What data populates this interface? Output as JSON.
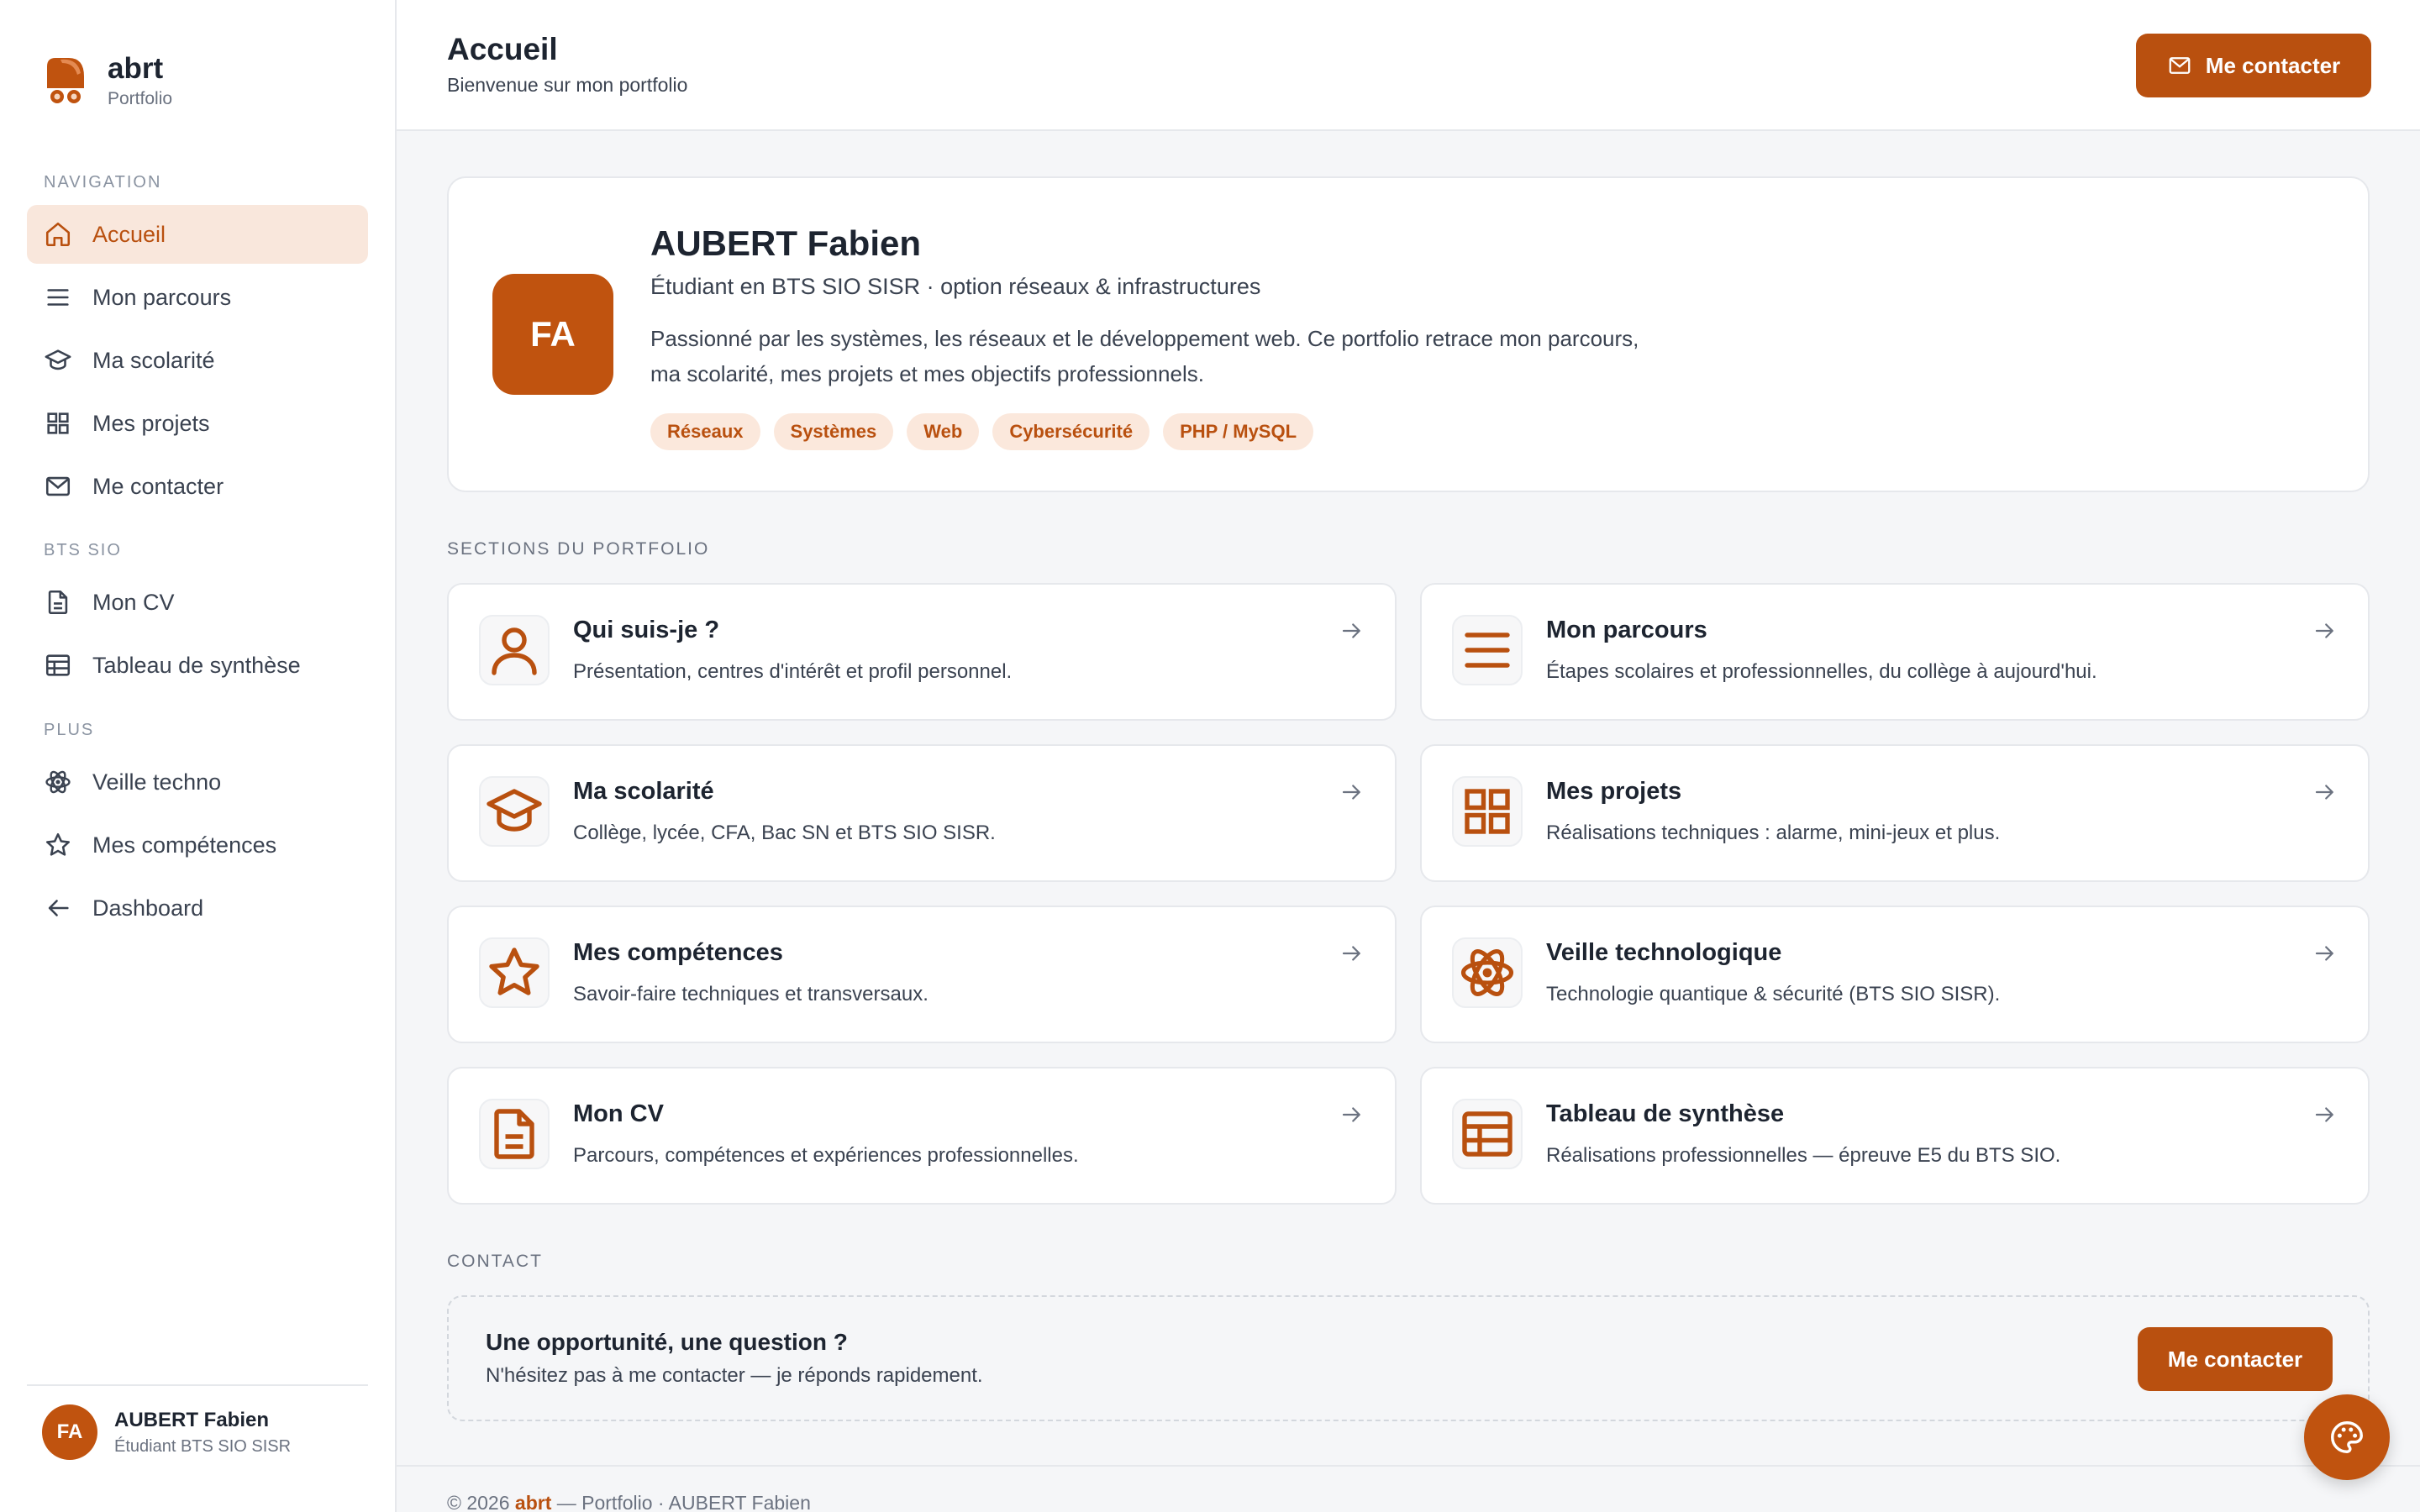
{
  "brand": {
    "name": "abrt",
    "subtitle": "Portfolio",
    "logo_icon": "brand-logo-icon"
  },
  "sidebar": {
    "groups": [
      {
        "label": "NAVIGATION",
        "items": [
          {
            "label": "Accueil",
            "icon": "home-icon",
            "active": true
          },
          {
            "label": "Mon parcours",
            "icon": "menu-lines-icon"
          },
          {
            "label": "Ma scolarité",
            "icon": "graduation-cap-icon"
          },
          {
            "label": "Mes projets",
            "icon": "grid-icon"
          },
          {
            "label": "Me contacter",
            "icon": "mail-icon"
          }
        ]
      },
      {
        "label": "BTS SIO",
        "items": [
          {
            "label": "Mon CV",
            "icon": "document-icon"
          },
          {
            "label": "Tableau de synthèse",
            "icon": "table-icon"
          }
        ]
      },
      {
        "label": "PLUS",
        "items": [
          {
            "label": "Veille techno",
            "icon": "atom-icon"
          },
          {
            "label": "Mes compétences",
            "icon": "star-icon"
          },
          {
            "label": "Dashboard",
            "icon": "arrow-left-icon"
          }
        ]
      }
    ],
    "user": {
      "initials": "FA",
      "name": "AUBERT Fabien",
      "role": "Étudiant BTS SIO SISR"
    }
  },
  "header": {
    "title": "Accueil",
    "subtitle": "Bienvenue sur mon portfolio",
    "contact_button": "Me contacter"
  },
  "hero": {
    "initials": "FA",
    "name": "AUBERT Fabien",
    "role": "Étudiant en BTS SIO SISR · option réseaux & infrastructures",
    "description": "Passionné par les systèmes, les réseaux et le développement web. Ce portfolio retrace mon parcours, ma scolarité, mes projets et mes objectifs professionnels.",
    "tags": [
      "Réseaux",
      "Systèmes",
      "Web",
      "Cybersécurité",
      "PHP / MySQL"
    ]
  },
  "sections": {
    "label": "SECTIONS DU PORTFOLIO",
    "cards": [
      {
        "title": "Qui suis-je ?",
        "desc": "Présentation, centres d'intérêt et profil personnel.",
        "icon": "user-icon"
      },
      {
        "title": "Mon parcours",
        "desc": "Étapes scolaires et professionnelles, du collège à aujourd'hui.",
        "icon": "menu-lines-icon"
      },
      {
        "title": "Ma scolarité",
        "desc": "Collège, lycée, CFA, Bac SN et BTS SIO SISR.",
        "icon": "graduation-cap-icon"
      },
      {
        "title": "Mes projets",
        "desc": "Réalisations techniques : alarme, mini-jeux et plus.",
        "icon": "grid-icon"
      },
      {
        "title": "Mes compétences",
        "desc": "Savoir-faire techniques et transversaux.",
        "icon": "star-icon"
      },
      {
        "title": "Veille technologique",
        "desc": "Technologie quantique & sécurité (BTS SIO SISR).",
        "icon": "atom-icon"
      },
      {
        "title": "Mon CV",
        "desc": "Parcours, compétences et expériences professionnelles.",
        "icon": "document-icon"
      },
      {
        "title": "Tableau de synthèse",
        "desc": "Réalisations professionnelles — épreuve E5 du BTS SIO.",
        "icon": "table-icon"
      }
    ]
  },
  "contact": {
    "label": "CONTACT",
    "title": "Une opportunité, une question ?",
    "subtitle": "N'hésitez pas à me contacter — je réponds rapidement.",
    "button": "Me contacter"
  },
  "footer": {
    "prefix": "© 2026 ",
    "brand": "abrt",
    "suffix": " — Portfolio · AUBERT Fabien"
  },
  "fab": {
    "icon": "palette-icon"
  },
  "colors": {
    "accent": "#b9500f",
    "accent_soft": "#f9e7dc",
    "background": "#f5f6f8"
  }
}
